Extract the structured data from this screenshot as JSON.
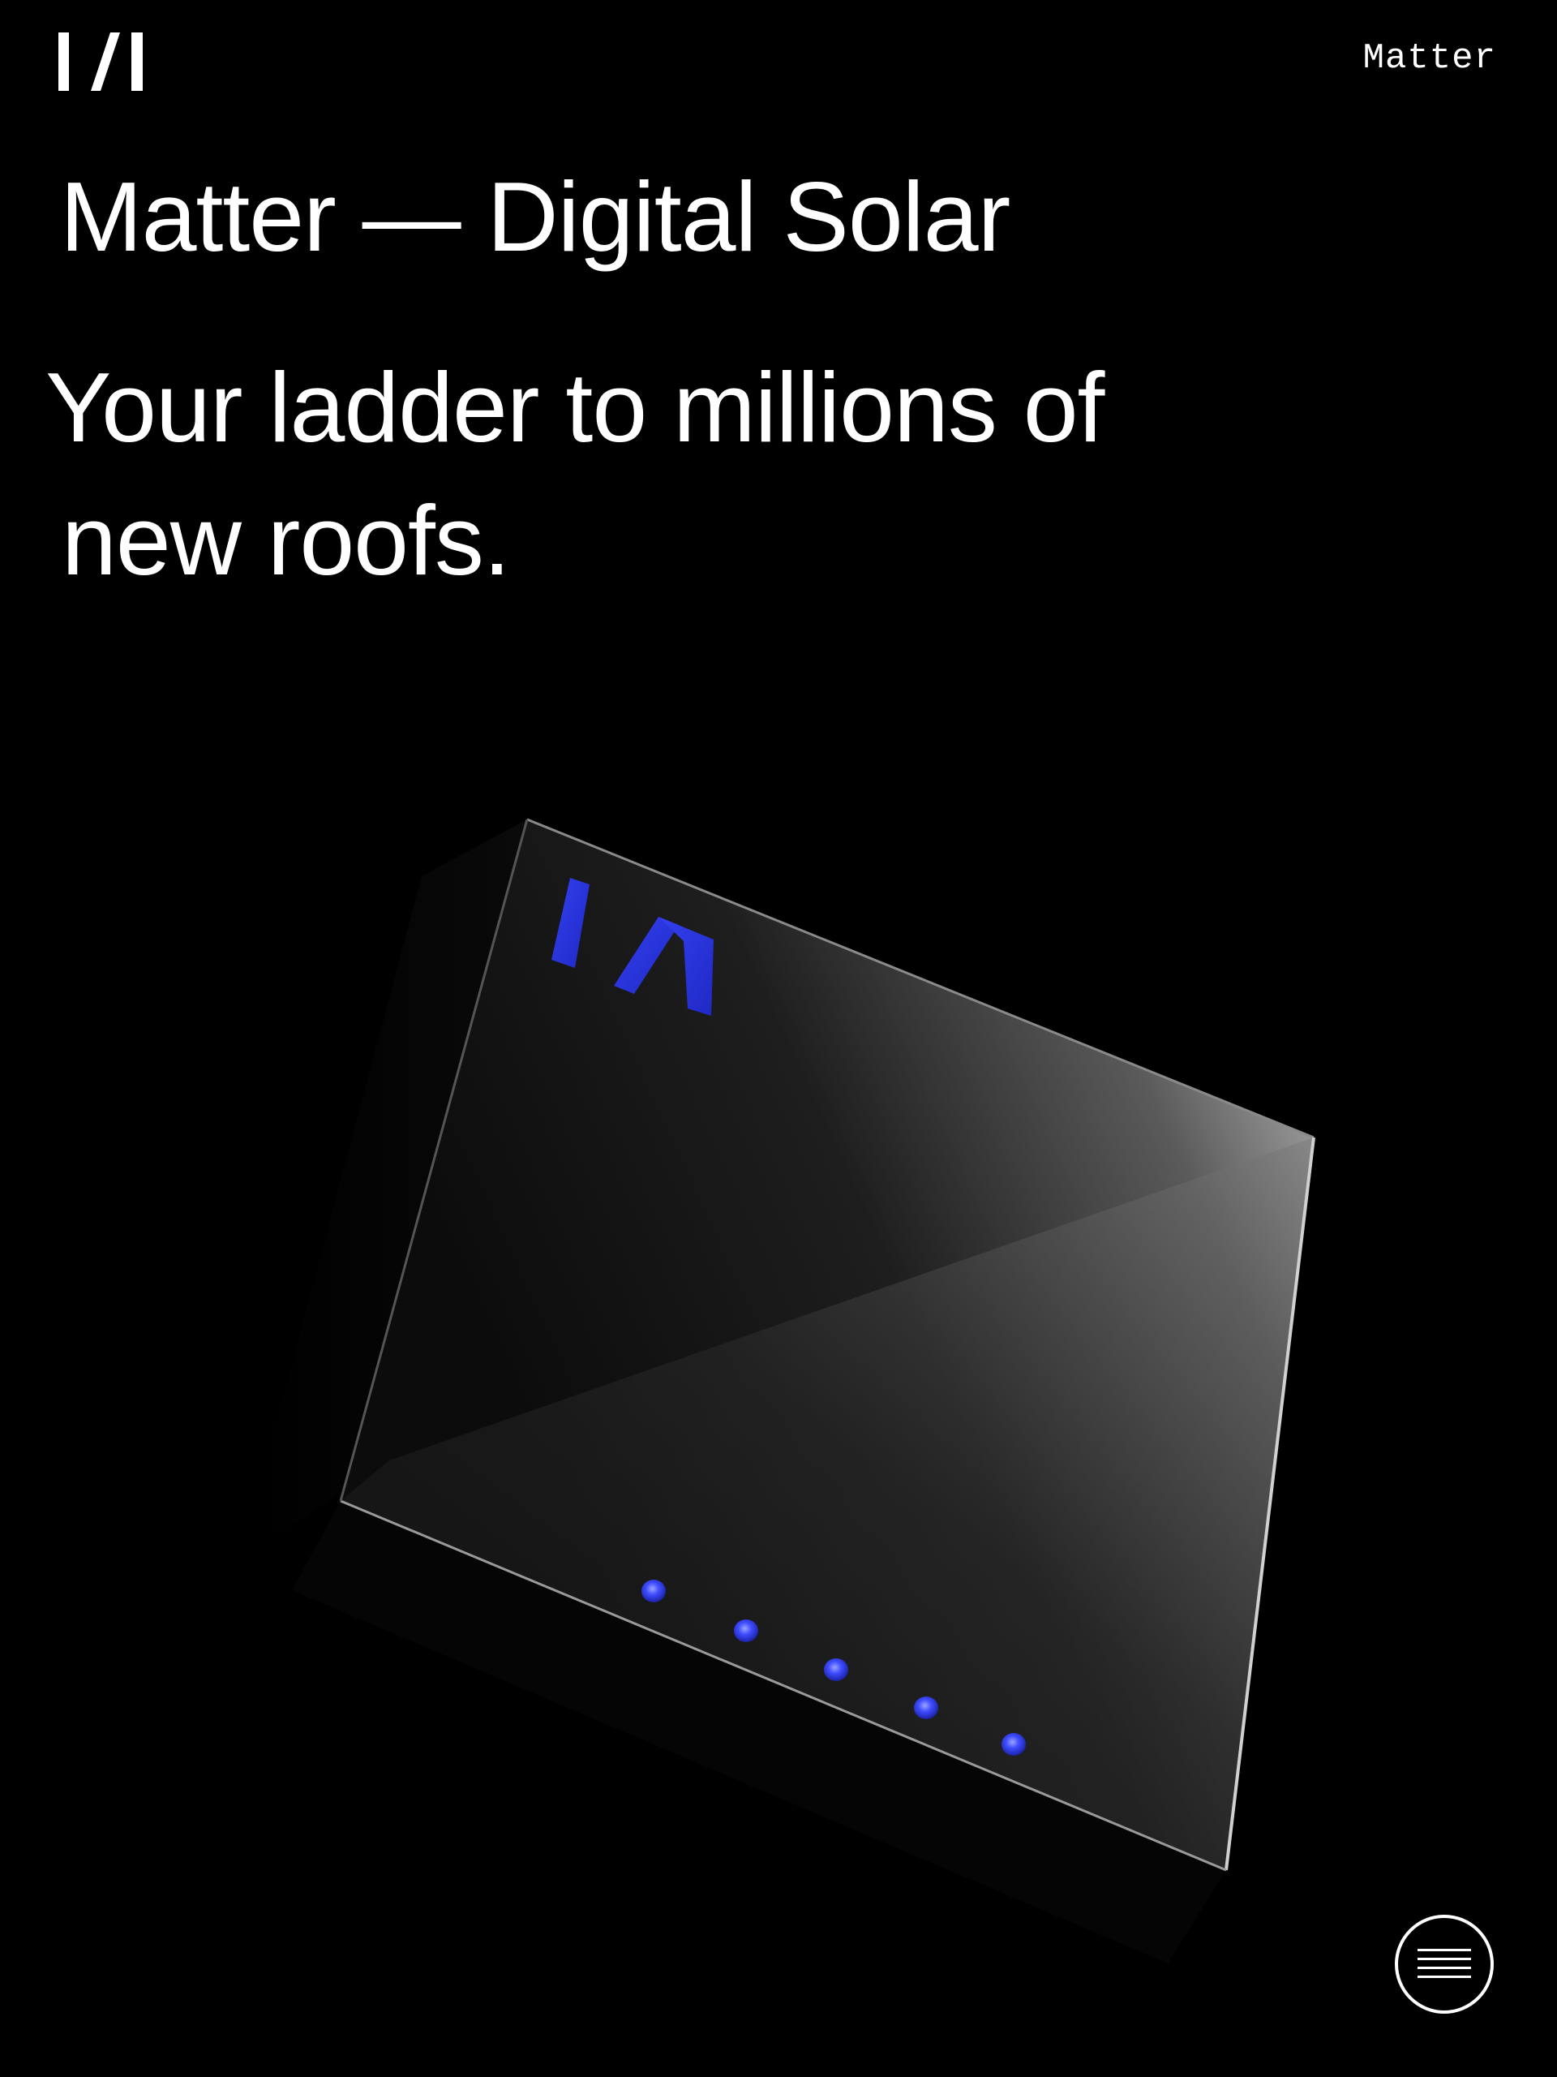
{
  "header": {
    "logo_icon": "matter-logo-icon",
    "brand": "Matter"
  },
  "hero": {
    "title": "Matter — Digital Solar",
    "headline_line1": "Your ladder to millions of",
    "headline_line2": "new roofs.",
    "device_image": "matter-device-render",
    "accent_color": "#2a39e8"
  },
  "menu": {
    "icon": "menu-icon"
  },
  "colors": {
    "background": "#000000",
    "text": "#ffffff",
    "accent": "#2a39e8"
  }
}
